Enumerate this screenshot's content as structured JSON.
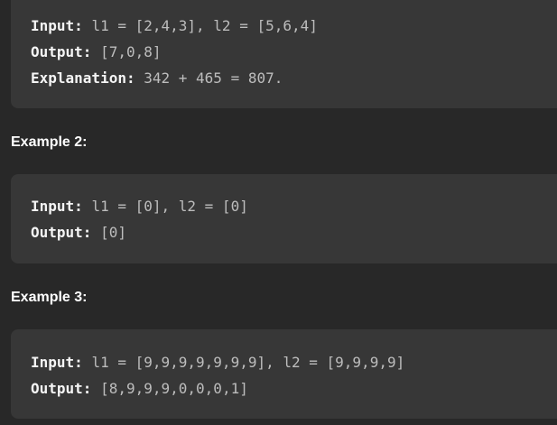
{
  "example1": {
    "input_label": "Input:",
    "input_value": "l1 = [2,4,3], l2 = [5,6,4]",
    "output_label": "Output:",
    "output_value": "[7,0,8]",
    "explanation_label": "Explanation:",
    "explanation_value": "342 + 465 = 807."
  },
  "example2": {
    "heading": "Example 2:",
    "input_label": "Input:",
    "input_value": "l1 = [0], l2 = [0]",
    "output_label": "Output:",
    "output_value": "[0]"
  },
  "example3": {
    "heading": "Example 3:",
    "input_label": "Input:",
    "input_value": "l1 = [9,9,9,9,9,9,9], l2 = [9,9,9,9]",
    "output_label": "Output:",
    "output_value": "[8,9,9,9,0,0,0,1]"
  },
  "colors": {
    "background": "#282828",
    "block": "#373737",
    "heading": "#ffffff",
    "label": "#f5f5f5",
    "value": "#bdbdbd"
  }
}
